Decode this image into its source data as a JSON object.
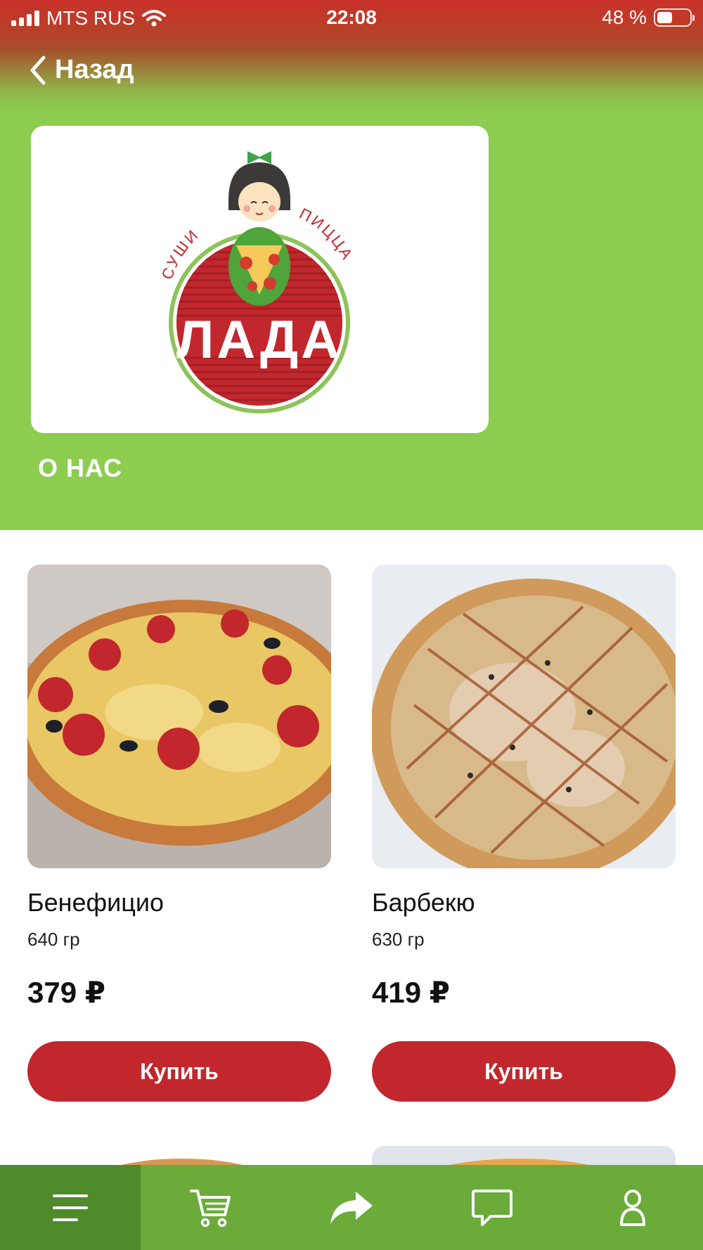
{
  "status_bar": {
    "carrier": "MTS RUS",
    "time": "22:08",
    "battery": "48 %",
    "battery_level": 0.48
  },
  "nav": {
    "back_label": "Назад"
  },
  "brand": {
    "name": "ЛАДА",
    "tagline_left": "СУШИ",
    "tagline_right": "ПИЦЦА",
    "colors": {
      "red": "#c1272d",
      "green": "#8ccd50"
    }
  },
  "about_label": "О НАС",
  "products": [
    {
      "title": "Бенефицио",
      "weight": "640 гр",
      "price": "379 ₽",
      "buy_label": "Купить"
    },
    {
      "title": "Барбекю",
      "weight": "630 гр",
      "price": "419 ₽",
      "buy_label": "Купить"
    }
  ],
  "tabbar": {
    "items": [
      {
        "icon": "menu-icon",
        "active": true
      },
      {
        "icon": "cart-icon",
        "active": false
      },
      {
        "icon": "share-icon",
        "active": false
      },
      {
        "icon": "chat-icon",
        "active": false
      },
      {
        "icon": "profile-icon",
        "active": false
      }
    ]
  }
}
